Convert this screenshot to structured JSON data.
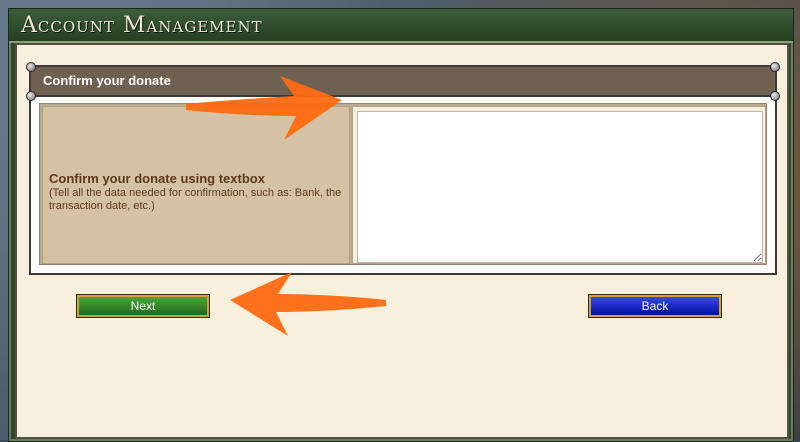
{
  "window": {
    "title": "Account Management"
  },
  "panel": {
    "header": "Confirm your donate",
    "field_label": "Confirm your donate using textbox",
    "field_help": "(Tell all the data needed for confirmation, such as: Bank, the transaction date, etc.)",
    "textarea_value": ""
  },
  "buttons": {
    "next_label": "Next",
    "back_label": "Back"
  },
  "colors": {
    "next_button": "#2e8a28",
    "back_button": "#1a22d0",
    "arrow": "#ff6a10"
  }
}
